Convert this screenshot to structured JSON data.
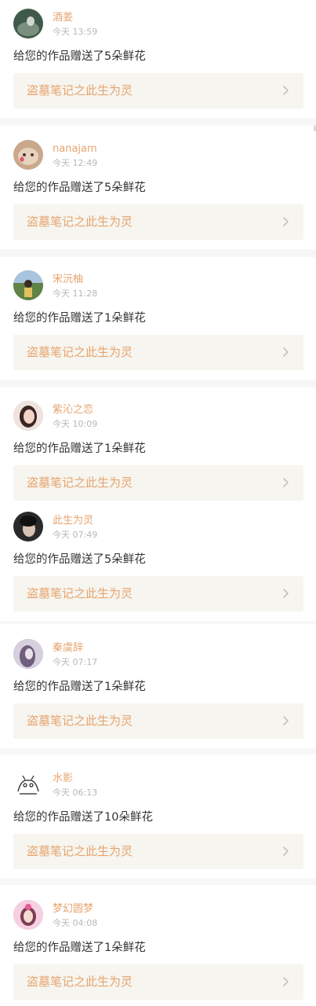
{
  "feed": [
    {
      "username": "酒姜",
      "time": "今天 13:59",
      "message": "给您的作品赠送了5朵鲜花",
      "work": "盗墓笔记之此生为灵",
      "avatar_icon": "avatar-landscape-photo",
      "avatar_color": "#3f5a4a"
    },
    {
      "username": "nanajam",
      "time": "今天 12:49",
      "message": "给您的作品赠送了5朵鲜花",
      "work": "盗墓笔记之此生为灵",
      "avatar_icon": "avatar-cat-photo",
      "avatar_color": "#caa88c"
    },
    {
      "username": "宋沅柚",
      "time": "今天 11:28",
      "message": "给您的作品赠送了1朵鲜花",
      "work": "盗墓笔记之此生为灵",
      "avatar_icon": "avatar-outdoor-photo",
      "avatar_color": "#6e8b5a"
    },
    {
      "username": "紫沁之恋",
      "time": "今天 10:09",
      "message": "给您的作品赠送了1朵鲜花",
      "work": "盗墓笔记之此生为灵",
      "avatar_icon": "avatar-girl-photo",
      "avatar_color": "#c79a9a"
    },
    {
      "username": "此生为灵",
      "time": "今天 07:49",
      "message": "给您的作品赠送了5朵鲜花",
      "work": "盗墓笔记之此生为灵",
      "avatar_icon": "avatar-dark-portrait",
      "avatar_color": "#2a2a2a"
    },
    {
      "username": "秦虞辞",
      "time": "今天 07:17",
      "message": "给您的作品赠送了1朵鲜花",
      "work": "盗墓笔记之此生为灵",
      "avatar_icon": "avatar-purple-portrait",
      "avatar_color": "#9c8fb0"
    },
    {
      "username": "水影",
      "time": "今天 06:13",
      "message": "给您的作品赠送了10朵鲜花",
      "work": "盗墓笔记之此生为灵",
      "avatar_icon": "avatar-doodle-drawing",
      "avatar_color": "#ffffff"
    },
    {
      "username": "梦幻圆梦",
      "time": "今天 04:08",
      "message": "给您的作品赠送了1朵鲜花",
      "work": "盗墓笔记之此生为灵",
      "avatar_icon": "avatar-pink-portrait",
      "avatar_color": "#e8a2c4"
    }
  ]
}
